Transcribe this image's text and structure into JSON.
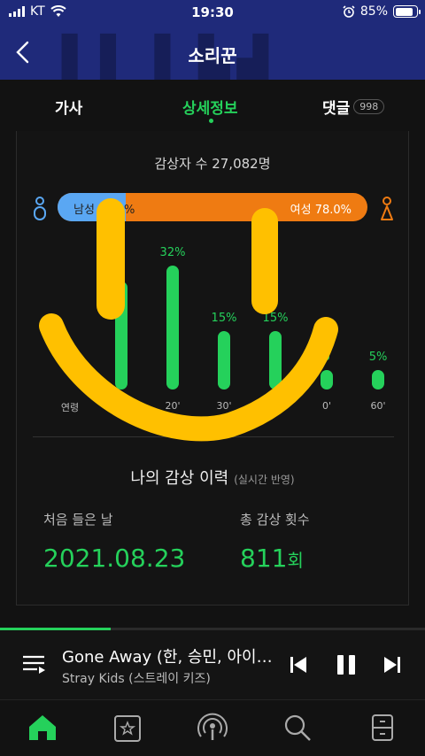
{
  "status": {
    "carrier": "KT",
    "time": "19:30",
    "battery": "85%",
    "battery_level": 0.85
  },
  "header": {
    "title": "소리꾼"
  },
  "tabs": {
    "lyrics": "가사",
    "detail": "상세정보",
    "comments": "댓글",
    "comments_count": "998"
  },
  "listeners": {
    "text": "감상자 수 27,082명"
  },
  "gender": {
    "male_label": "남성 22.0%",
    "female_label": "여성 78.0%",
    "male_ratio": 0.22
  },
  "ages": [
    {
      "label": "연령",
      "pct": "",
      "value": 0
    },
    {
      "label": "",
      "pct": "2",
      "value": 28
    },
    {
      "label": "20'",
      "pct": "32%",
      "value": 32
    },
    {
      "label": "30'",
      "pct": "15%",
      "value": 15
    },
    {
      "label": "4",
      "pct": "15%",
      "value": 15
    },
    {
      "label": "0'",
      "pct": "5",
      "value": 5
    },
    {
      "label": "60'",
      "pct": "5%",
      "value": 5
    }
  ],
  "history": {
    "title": "나의 감상 이력",
    "subtitle": "(실시간 반영)",
    "first_label": "처음 들은 날",
    "first_value": "2021.08.23",
    "total_label": "총 감상 횟수",
    "total_value": "811",
    "total_unit": "회"
  },
  "player": {
    "title": "Gone Away (한, 승민, 아이…",
    "artist": "Stray Kids (스트레이 키즈)",
    "progress": 0.26
  },
  "colors": {
    "accent": "#25d15b",
    "male": "#5aa7f3",
    "female": "#ef7b12",
    "header": "#1f2a7a",
    "scribble": "#ffc000"
  }
}
